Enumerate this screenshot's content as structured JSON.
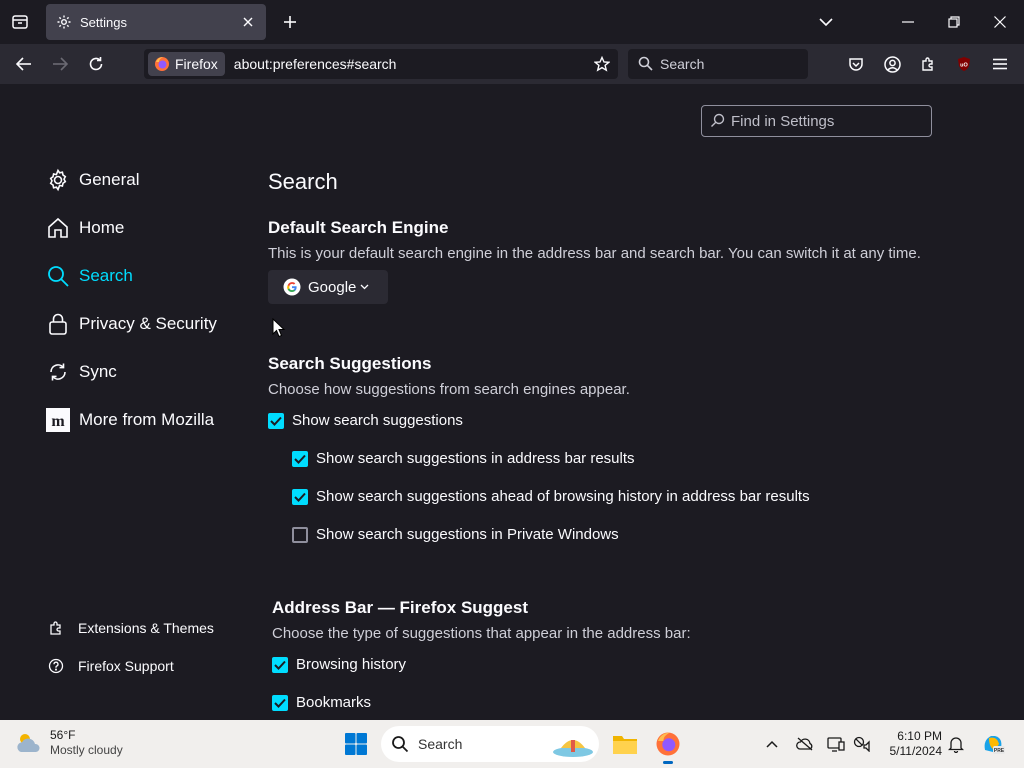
{
  "browser": {
    "tab_title": "Settings",
    "identity_label": "Firefox",
    "url": "about:preferences#search",
    "search_placeholder": "Search"
  },
  "settings": {
    "find_placeholder": "Find in Settings",
    "nav": [
      {
        "label": "General",
        "icon": "gear-icon"
      },
      {
        "label": "Home",
        "icon": "home-icon"
      },
      {
        "label": "Search",
        "icon": "search-icon",
        "active": true
      },
      {
        "label": "Privacy & Security",
        "icon": "lock-icon"
      },
      {
        "label": "Sync",
        "icon": "sync-icon"
      },
      {
        "label": "More from Mozilla",
        "icon": "mozilla-icon"
      }
    ],
    "footer_nav": [
      {
        "label": "Extensions & Themes",
        "icon": "puzzle-icon"
      },
      {
        "label": "Firefox Support",
        "icon": "help-icon"
      }
    ],
    "page_title": "Search",
    "default_engine": {
      "heading": "Default Search Engine",
      "description": "This is your default search engine in the address bar and search bar. You can switch it at any time.",
      "selected": "Google"
    },
    "suggestions": {
      "heading": "Search Suggestions",
      "description": "Choose how suggestions from search engines appear.",
      "options": [
        {
          "label": "Show search suggestions",
          "checked": true
        },
        {
          "label": "Show search suggestions in address bar results",
          "checked": true
        },
        {
          "label": "Show search suggestions ahead of browsing history in address bar results",
          "checked": true
        },
        {
          "label": "Show search suggestions in Private Windows",
          "checked": false
        }
      ]
    },
    "firefox_suggest": {
      "heading": "Address Bar — Firefox Suggest",
      "description": "Choose the type of suggestions that appear in the address bar:",
      "options": [
        {
          "label": "Browsing history",
          "checked": true
        },
        {
          "label": "Bookmarks",
          "checked": true
        }
      ]
    }
  },
  "taskbar": {
    "weather_temp": "56°F",
    "weather_condition": "Mostly cloudy",
    "search_label": "Search",
    "time": "6:10 PM",
    "date": "5/11/2024"
  },
  "colors": {
    "accent": "#00ddff",
    "background": "#1c1b22",
    "toolbar": "#2b2a33"
  }
}
